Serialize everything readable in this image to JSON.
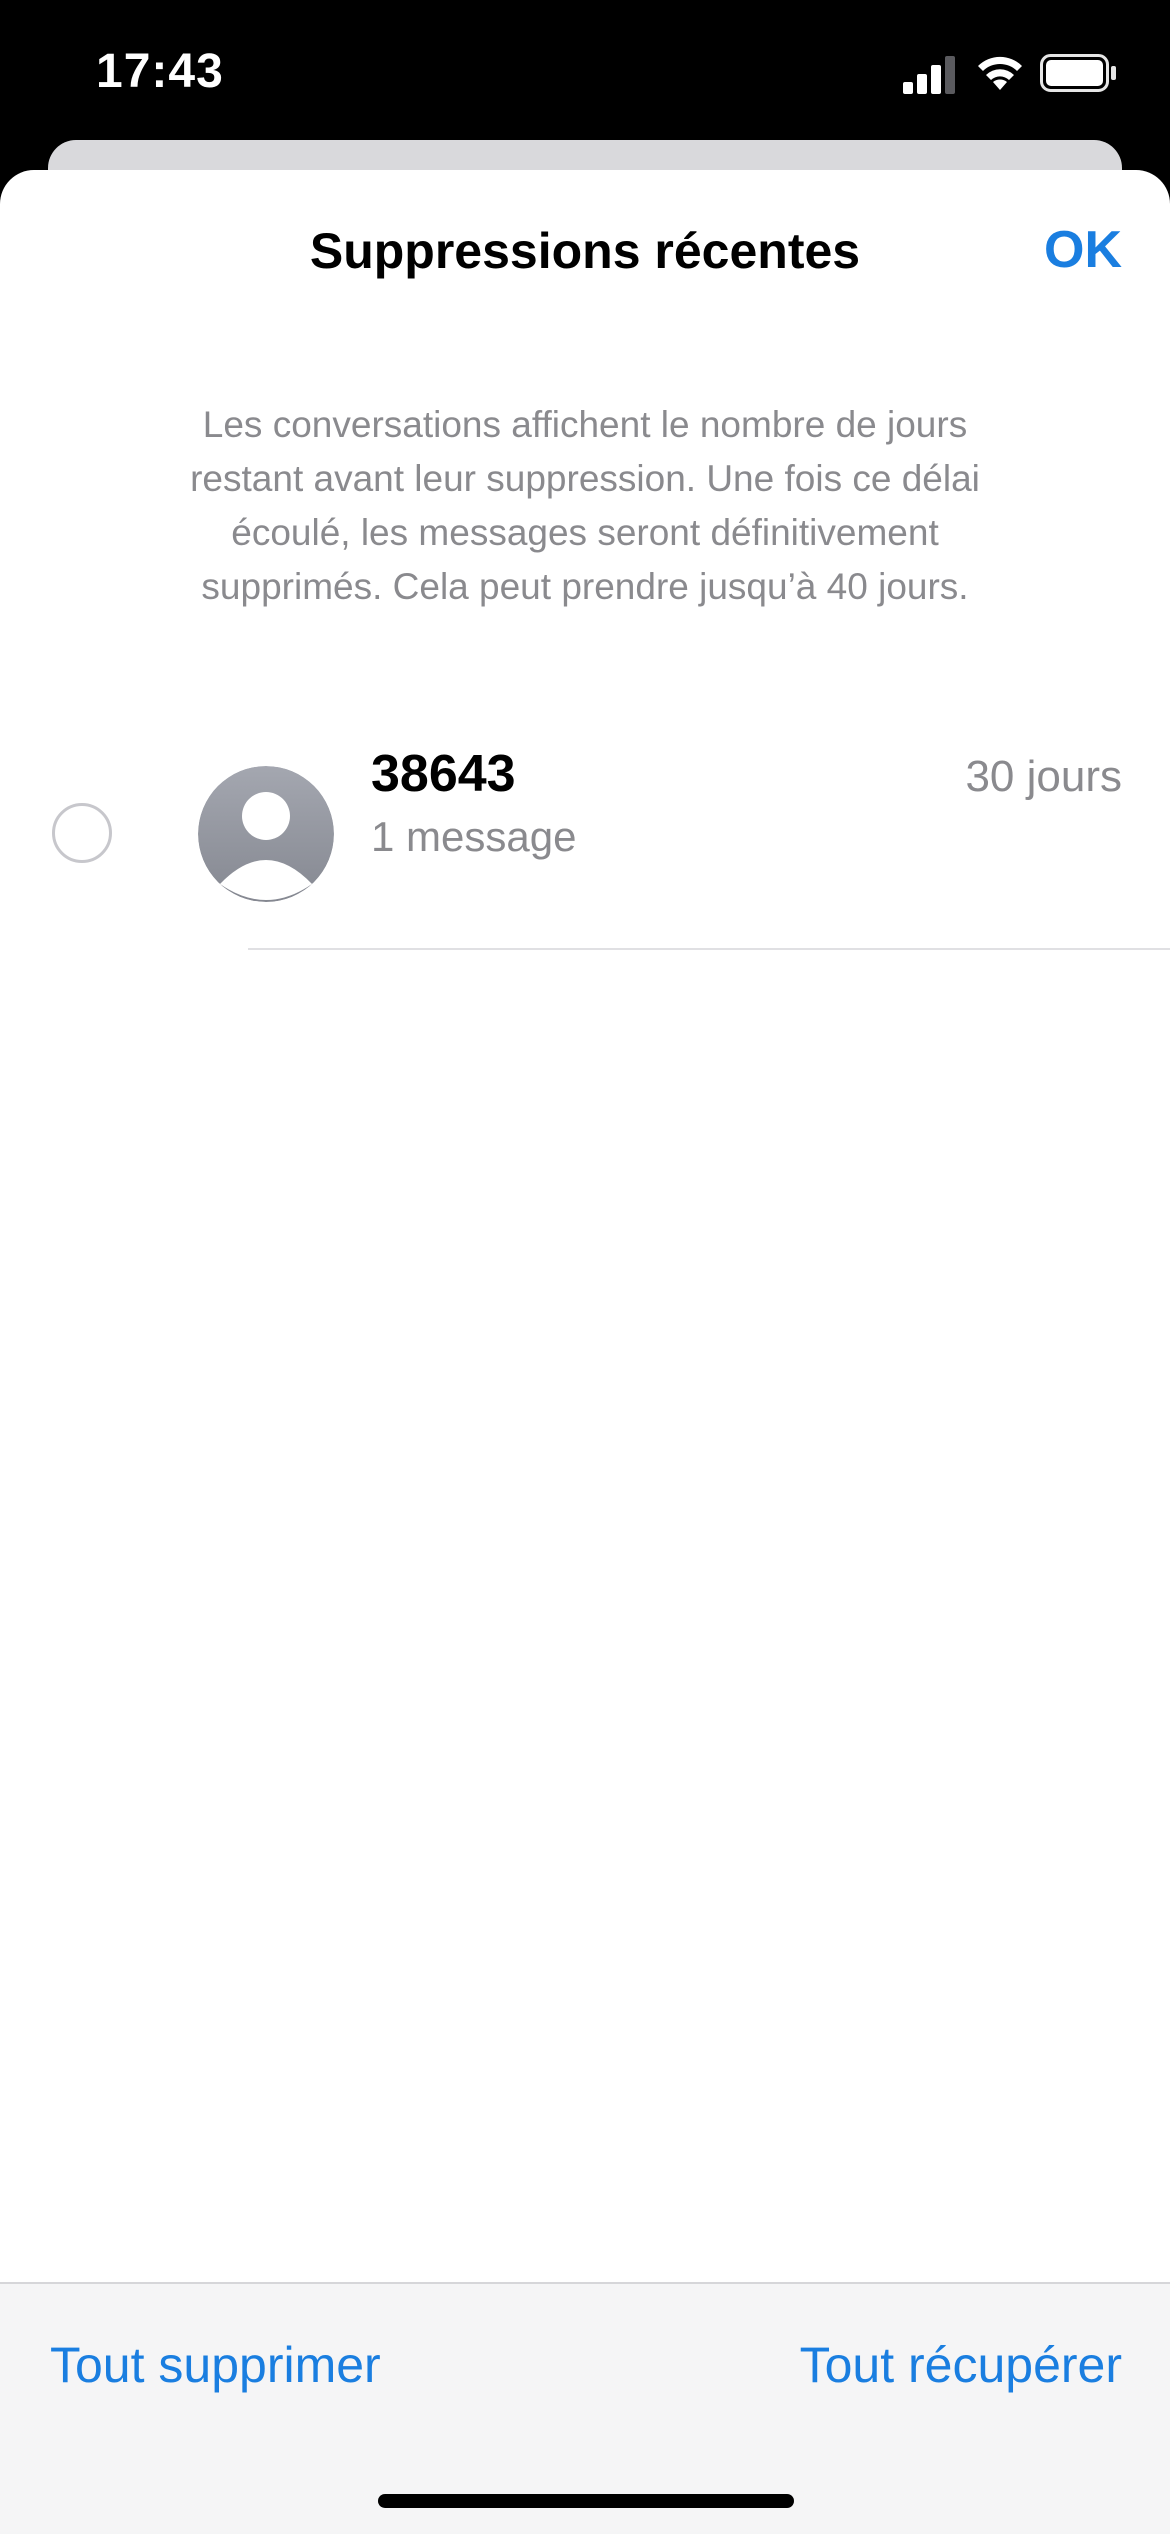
{
  "status_bar": {
    "time": "17:43",
    "icons": [
      "signal-icon",
      "wifi-icon",
      "battery-icon"
    ]
  },
  "sheet": {
    "title": "Suppressions récentes",
    "ok_label": "OK",
    "description": "Les conversations affichent le nombre de jours restant avant leur suppression. Une fois ce délai écoulé, les messages seront définitivement supprimés. Cela peut prendre jusqu’à 40 jours."
  },
  "conversations": [
    {
      "name": "38643",
      "subtitle": "1 message",
      "days_left": "30 jours",
      "selected": false,
      "avatar_icon": "person-avatar-icon"
    }
  ],
  "toolbar": {
    "delete_all_label": "Tout supprimer",
    "recover_all_label": "Tout récupérer"
  },
  "colors": {
    "accent": "#1a7ee0",
    "secondary_text": "#8a8a8e",
    "toolbar_bg": "#f5f5f6"
  }
}
